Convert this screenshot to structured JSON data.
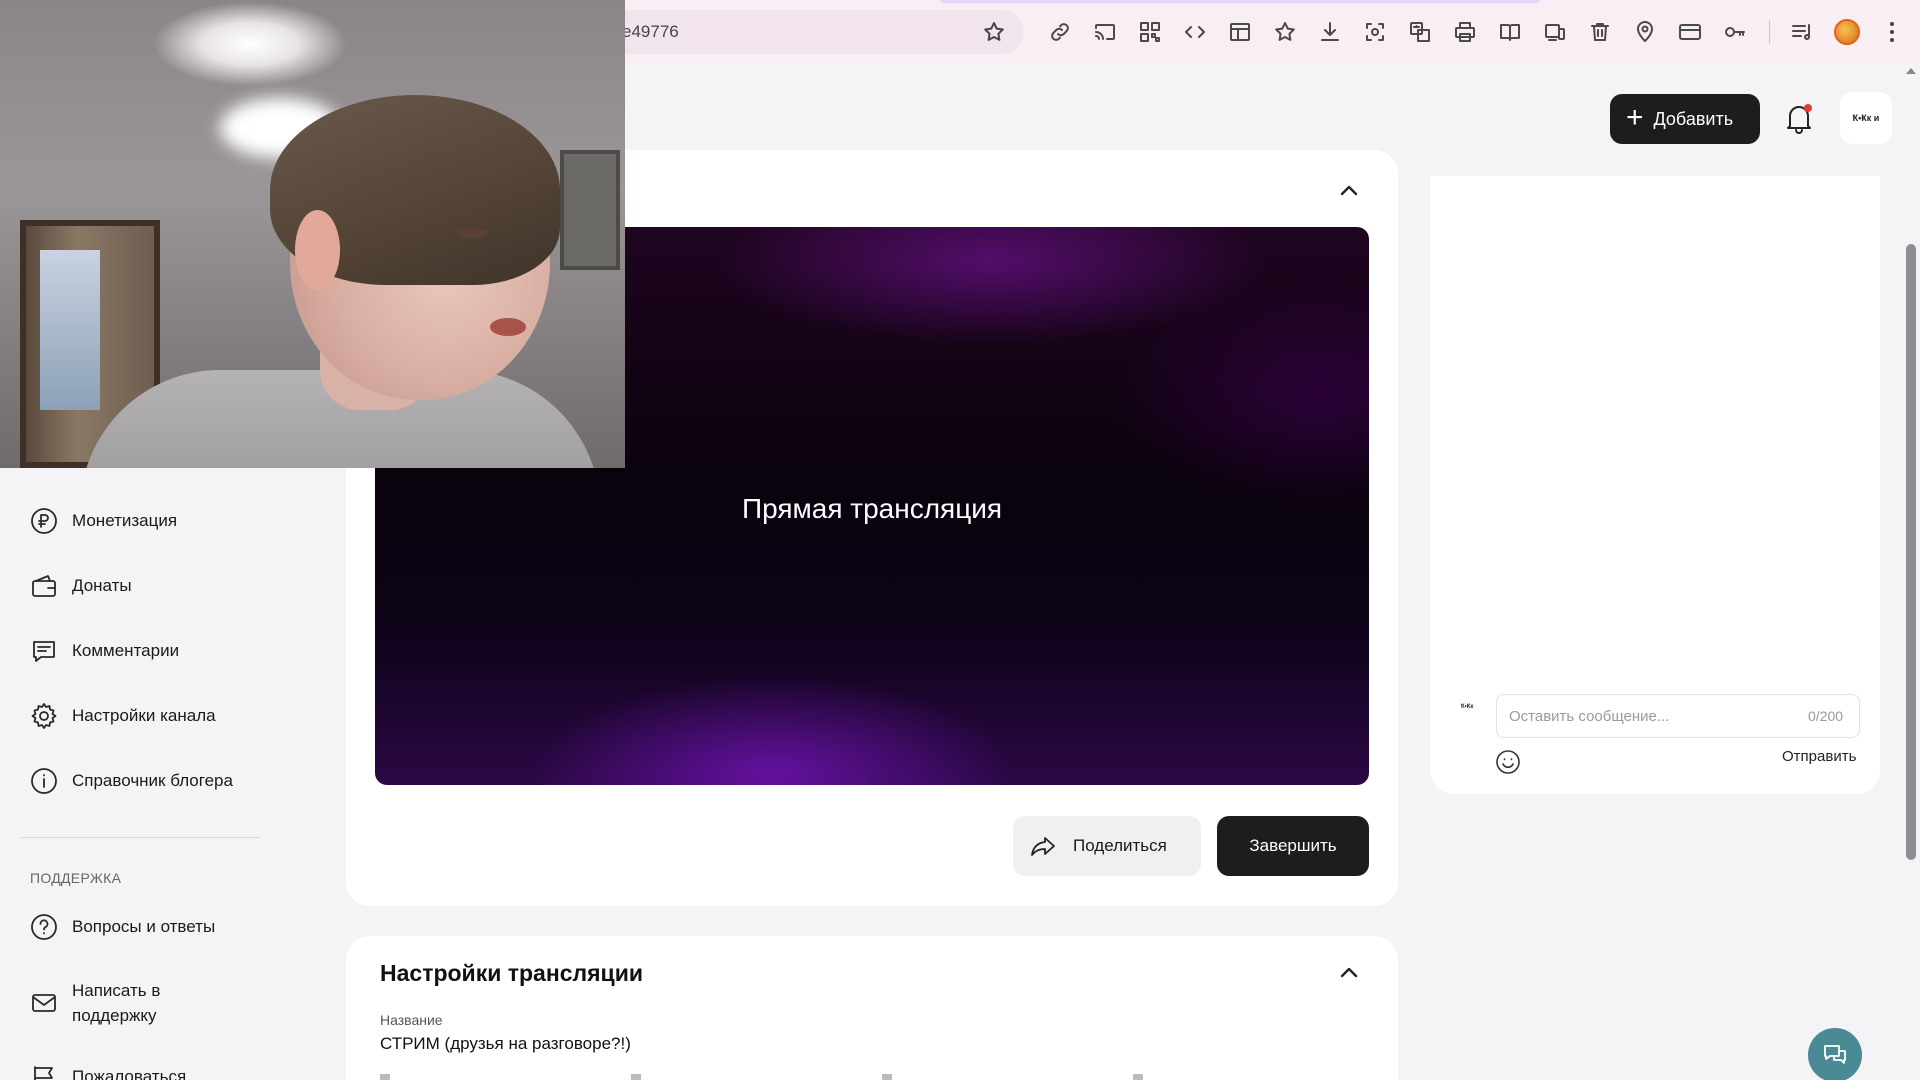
{
  "browser": {
    "url_fragment": "e49776",
    "toolbar_icons": [
      "link-icon",
      "cast-icon",
      "qr-code-icon",
      "code-icon",
      "layout-icon",
      "bookmark-star-icon",
      "download-icon",
      "screenshot-icon",
      "translate-icon",
      "print-icon",
      "reader-icon",
      "devices-icon",
      "trash-icon",
      "location-icon",
      "card-icon",
      "key-icon",
      "media-icon"
    ],
    "profile_color": "#e0631c"
  },
  "header": {
    "add_label": "Добавить",
    "avatar_text": "Ҟ•Ҝк и"
  },
  "sidebar": {
    "items": [
      {
        "label": "Монетизация",
        "icon": "ruble-icon"
      },
      {
        "label": "Донаты",
        "icon": "wallet-icon"
      },
      {
        "label": "Комментарии",
        "icon": "comment-icon"
      },
      {
        "label": "Настройки канала",
        "icon": "gear-icon"
      },
      {
        "label": "Справочник блогера",
        "icon": "info-icon"
      }
    ],
    "support_section": "ПОДДЕРЖКА",
    "support_items": [
      {
        "label": "Вопросы и ответы",
        "icon": "question-icon"
      },
      {
        "label": "Написать в\nподдержку",
        "icon": "mail-icon"
      },
      {
        "label": "Пожаловаться",
        "icon": "flag-icon"
      }
    ]
  },
  "stream": {
    "player_title": "Прямая трансляция",
    "share_label": "Поделиться",
    "finish_label": "Завершить"
  },
  "settings": {
    "title": "Настройки трансляции",
    "name_label": "Название",
    "name_value": "СТРИМ (друзья на разговоре?!)"
  },
  "chat": {
    "mini_avatar_text": "Ҟ•Ҝк",
    "placeholder": "Оставить сообщение...",
    "counter": "0/200",
    "send_label": "Отправить"
  },
  "colors": {
    "primary_dark": "#1d1d1f",
    "help_fab": "#4a8a94",
    "notification_dot": "#e53935"
  }
}
